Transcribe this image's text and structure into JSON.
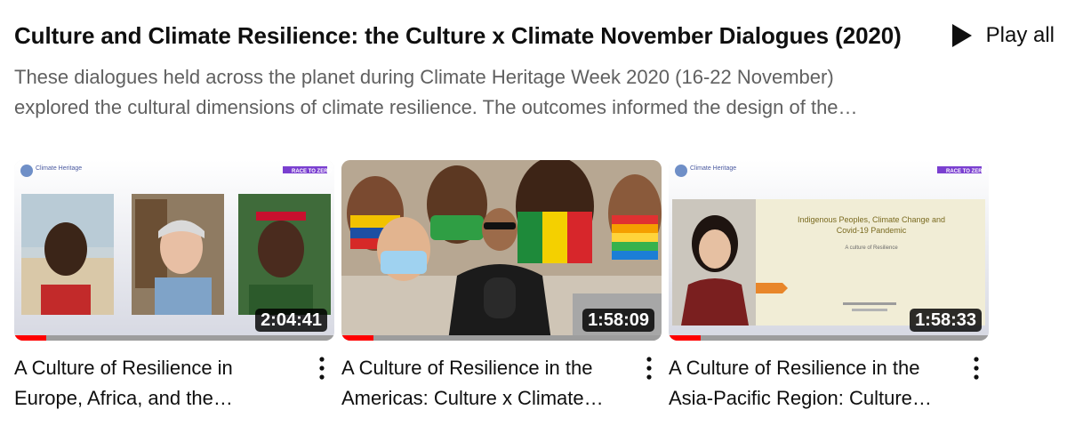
{
  "playlist": {
    "title": "Culture and Climate Resilience: the Culture x Climate November Dialogues (2020)",
    "play_all_label": "Play all",
    "description_line1": "These dialogues held across the planet during Climate Heritage Week 2020 (16-22 November)",
    "description_line2": "explored the cultural dimensions of climate resilience. The outcomes informed the design of the…"
  },
  "colors": {
    "progress": "#ff0000",
    "duration_bg": "#000000",
    "secondary_text": "#606060"
  },
  "videos": [
    {
      "title_line1": "A Culture of Resilience in",
      "title_line2": "Europe, Africa, and the…",
      "duration": "2:04:41",
      "watched_fraction": 0.1,
      "thumbnail": {
        "logo": "Climate Heritage",
        "banner": "RACE TO ZERO"
      }
    },
    {
      "title_line1": "A Culture of Resilience in the",
      "title_line2": "Americas: Culture x Climate…",
      "duration": "1:58:09",
      "watched_fraction": 0.1,
      "thumbnail": {}
    },
    {
      "title_line1": "A Culture of Resilience in the",
      "title_line2": "Asia-Pacific Region: Culture…",
      "duration": "1:58:33",
      "watched_fraction": 0.1,
      "thumbnail": {
        "logo": "Climate Heritage",
        "banner": "RACE TO ZERO",
        "slide_title_line1": "Indigenous Peoples, Climate Change and",
        "slide_title_line2": "Covid-19 Pandemic",
        "slide_subtitle": "A culture of Resilience"
      }
    }
  ]
}
